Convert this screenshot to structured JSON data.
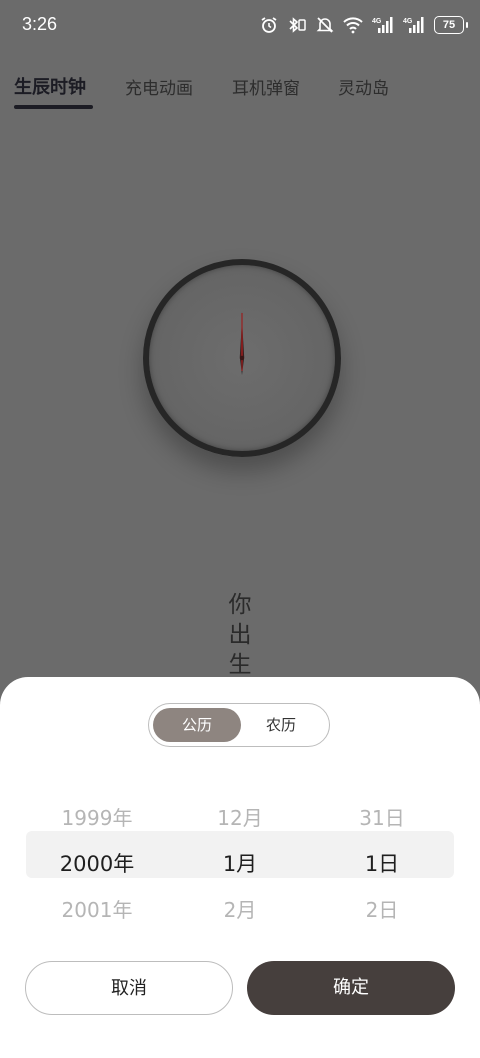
{
  "status_bar": {
    "time": "3:26",
    "icons": [
      "alarm-icon",
      "bluetooth-vibrate-icon",
      "mute-bell-icon",
      "wifi-icon",
      "signal-4g-icon",
      "signal-4g-icon"
    ],
    "battery": "75"
  },
  "tabs": [
    {
      "label": "生辰时钟",
      "active": true
    },
    {
      "label": "充电动画",
      "active": false
    },
    {
      "label": "耳机弹窗",
      "active": false
    },
    {
      "label": "灵动岛",
      "active": false
    }
  ],
  "main": {
    "vertical_text": "你出生"
  },
  "sheet": {
    "calendar_toggle": {
      "solar": "公历",
      "lunar": "农历",
      "selected": "公历"
    },
    "picker": {
      "years": [
        "1999年",
        "2000年",
        "2001年"
      ],
      "months": [
        "12月",
        "1月",
        "2月"
      ],
      "days": [
        "31日",
        "1日",
        "2日"
      ],
      "selected_index": 1
    },
    "cancel_label": "取消",
    "confirm_label": "确定"
  },
  "colors": {
    "overlay": "#6b6b6b",
    "accent_dark": "#463f3d",
    "toggle_selected": "#8e8580",
    "second_hand": "#8b1a1a"
  }
}
